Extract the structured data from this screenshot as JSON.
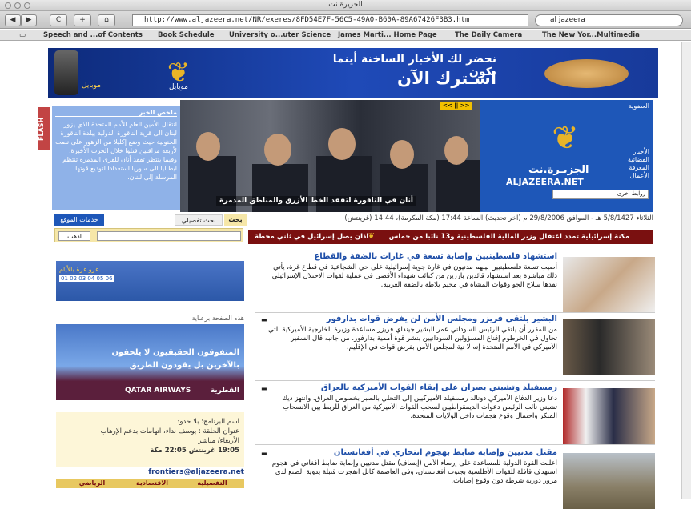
{
  "window": {
    "title": "الجزيرة نت"
  },
  "toolbar": {
    "back": "◀",
    "forward": "▶",
    "reload": "C",
    "add": "+",
    "home": "⌂",
    "url": "http://www.aljazeera.net/NR/exeres/8FD54E7F-56C5-49A0-B60A-89A67426F3B3.htm",
    "search_value": "al jazeera"
  },
  "bookmarks": [
    "Speech and ...of Contents",
    "Book Schedule",
    "University o...uter Science",
    "James Marti... Home Page",
    "The Daily Camera",
    "The New Yor...Multimedia"
  ],
  "banner": {
    "line1": "نحضر لك الأخبار الساخنة أينما تكون",
    "line2": "اشـترك الآن",
    "mobile_label": "موبايل",
    "logo_glyph": "❦"
  },
  "flash": {
    "label": "FLASH"
  },
  "news_summary": {
    "header": "ملخص الخبر",
    "body": "انتقال الأمين العام للأمم المتحدة الذي يزور لبنان الى قرية الناقورة الدولية بيلدة الناقورة الجنوبية حيث وضع إكليلا من الزهور على نصب لأربعة مراقبين قتلوا خلال الحرب الأخيرة، وفيما ينتظر تفقد أنان للقرى المدمرة تنتظم ايطاليا الى سوريا استعدادا لتوديع قوتها المرسلة إلى لبنان."
  },
  "photo": {
    "controls": "<< || >>",
    "caption": "أنان في الناقورة لتفقد الخط الأزرق والمناطق المدمرة"
  },
  "aj_panel": {
    "membership": "العضوية",
    "menu": [
      "الأخبار",
      "الفضائية",
      "المعرفة",
      "الأعمال"
    ],
    "name_ar": "الجزيـرة.نت",
    "name_en": "ALJAZEERA.NET",
    "select": "روابط أخرى"
  },
  "datebar": "الثلاثاء 5/8/1427 هـ - الموافق 29/8/2006 م (آخر تحديث) الساعة 17:44 (مكة المكرمة)، 14:44 (غرينتش)",
  "search_tabs": {
    "search": "بحث",
    "advanced": "بحث تفصيلي",
    "services": "خدمات الموقع",
    "go": "اذهب"
  },
  "ticker": {
    "left": "اذان يصل إسرائيل في ثاني محطة",
    "right": "مكنة إسرائيلية تمدد اعتقال وزير المالية الفلسطينية و13 نائبا من حماس"
  },
  "sidead": {
    "title": "غزو غزة بالأيام",
    "numbers": "01 02 03 04 05 06"
  },
  "sponsor_label": "هذه الصفحة برعـاية",
  "qatar": {
    "line1": "المتفوقون الحقيقيون لا يلحقون",
    "line2": "بالآخرين بل يقودون الطريق",
    "brand_en": "QATAR AIRWAYS",
    "brand_ar": "القطرية"
  },
  "program": {
    "name": "اسم البرنامج: بلا حدود",
    "title": "عنوان الحلقة : يوسف نداء، اتهامات بدعم الإرهاب",
    "day": "الأربعاء/ مباشر",
    "time": "19:05 غرينتش 22:05 مكة"
  },
  "email": "frontiers@aljazeera.net",
  "bottom_tabs": [
    "التفصيلية",
    "الاقتصادية",
    "الرياضي"
  ],
  "stories": [
    {
      "headline": "استشهاد فلسطينيين وإصابة تسعة في غارات بالضفة والقطاع",
      "text": "أصيب تسعة فلسطينيين بينهم مدنيون في غارة جوية إسرائيلية على حي الشجاعية في قطاع غزة، يأتي ذلك مباشرة بعد استشهاد قائدين بارزين من كتائب شهداء الأقصى في عملية لقوات الاحتلال الإسرائيلي نفذها سلاح الجو وقوات المشاة في مخيم بلاطة بالضفة الغربية."
    },
    {
      "headline": "البشير يلتقي فريزر ومجلس الأمن لن يفرض قوات بدارفور",
      "text": "من المقرر أن يلتقي الرئيس السوداني عمر البشير جينداي فريزر مساعدة وزيرة الخارجية الأميركية التي تحاول في الخرطوم إقناع المسؤولين السودانيين بنشر قوة أممية بدارفور، من جانبه قال السفير الأميركي في الأمم المتحدة إنه لا نية لمجلس الأمن بفرض قوات في الإقليم."
    },
    {
      "headline": "رمسفيلد وتشيني يصران على إبقاء القوات الأميركية بالعراق",
      "text": "دعا وزير الدفاع الأميركي دونالد رمسفيلد الأميركيين إلى التحلي بالصبر بخصوص العراق، وانتهز ديك تشيني نائب الرئيس دعوات الديمقراطيين لسحب القوات الأميركية من العراق للربط بين الانسحاب المبكر واحتمال وقوع هجمات داخل الولايات المتحدة."
    },
    {
      "headline": "مقتل مدنيين وإصابة ضابط بهجوم انتحاري في أفغانستان",
      "text": "أعلنت القوة الدولية للمساعدة على إرساء الأمن (إيساف) مقتل مدنيين وإصابة ضابط أفغاني في هجوم استهدف قافلة للقوات الأطلسية بجنوب أفغانستان، وفي العاصمة كابل انفجرت قنبلة يدوية الصنع لدى مرور دورية شرطة دون وقوع إصابات."
    }
  ]
}
